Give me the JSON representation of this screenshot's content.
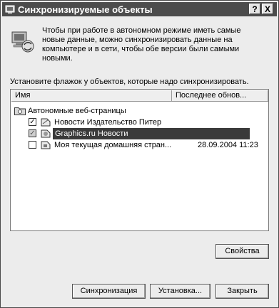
{
  "window": {
    "title": "Синхронизируемые объекты",
    "help_label": "?",
    "close_label": "X"
  },
  "intro": {
    "text": "Чтобы при работе в автономном режиме иметь самые новые данные, можно синхронизировать данные на компьютере и в сети, чтобы обе версии были самыми новыми."
  },
  "instruction": "Установите флажок у объектов, которые надо синхронизировать.",
  "list": {
    "columns": [
      "Имя",
      "Последнее обнов..."
    ],
    "group": "Автономные веб-страницы",
    "items": [
      {
        "label": "Новости  Издательство Питер",
        "date": "",
        "checked": true,
        "selected": false
      },
      {
        "label": "Graphics.ru  Новости",
        "date": "",
        "checked": true,
        "selected": true
      },
      {
        "label": "Моя текущая домашняя стран...",
        "date": "28.09.2004 11:23",
        "checked": false,
        "selected": false
      }
    ]
  },
  "buttons": {
    "properties": "Свойства",
    "sync": "Синхронизация",
    "setup": "Установка...",
    "close": "Закрыть"
  }
}
